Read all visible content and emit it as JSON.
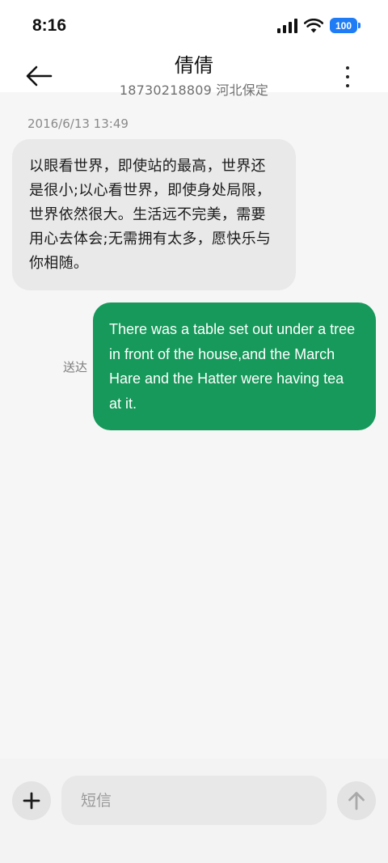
{
  "status_bar": {
    "time": "8:16",
    "battery": "100",
    "battery_color": "#1f7cf5",
    "icons": [
      "signal-icon",
      "wifi-icon",
      "battery-icon"
    ]
  },
  "header": {
    "back_icon": "back-arrow-icon",
    "title": "倩倩",
    "subtitle": "18730218809 河北保定",
    "more_icon": "more-vertical-icon"
  },
  "conversation": {
    "timestamp": "2016/6/13 13:49",
    "incoming": {
      "text": "以眼看世界，即使站的最高，世界还是很小;以心看世界，即使身处局限，世界依然很大。生活远不完美，需要用心去体会;无需拥有太多，愿快乐与你相随。"
    },
    "outgoing": {
      "status": "送达",
      "text": "There was a table set out under a tree in front of the house,and the March Hare and the Hatter were having tea at it.",
      "bubble_color": "#16995a"
    }
  },
  "composer": {
    "add_icon": "plus-icon",
    "placeholder": "短信",
    "value": "",
    "send_icon": "arrow-up-icon"
  }
}
